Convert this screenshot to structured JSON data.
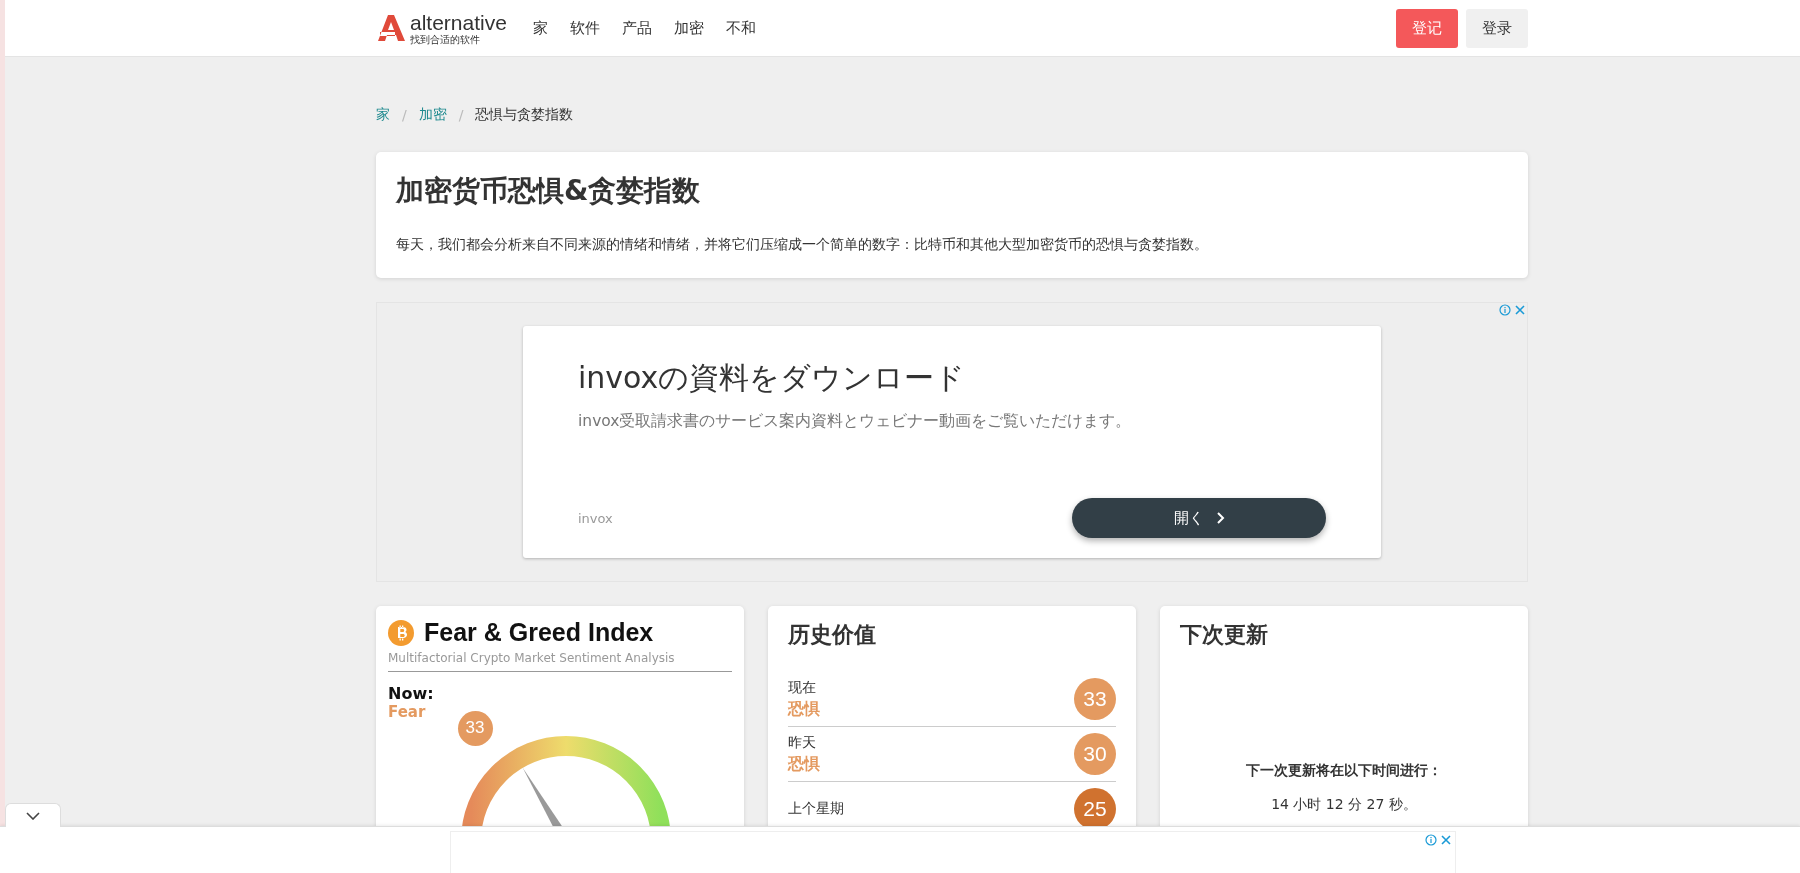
{
  "header": {
    "logo": {
      "name": "alternative",
      "tagline": "找到合适的软件"
    },
    "nav": [
      {
        "label": "家"
      },
      {
        "label": "软件"
      },
      {
        "label": "产品"
      },
      {
        "label": "加密"
      },
      {
        "label": "不和"
      }
    ],
    "buttons": [
      {
        "label": "登记",
        "kind": "primary"
      },
      {
        "label": "登录",
        "kind": "secondary"
      }
    ]
  },
  "breadcrumb_separator": "/",
  "breadcrumb": [
    {
      "label": "家",
      "link": true
    },
    {
      "label": "加密",
      "link": true
    },
    {
      "label": "恐惧与贪婪指数",
      "link": false
    }
  ],
  "intro": {
    "title": "加密货币恐惧&贪婪指数",
    "text": "每天，我们都会分析来自不同来源的情绪和情绪，并将它们压缩成一个简单的数字：比特币和其他大型加密货币的恐惧与贪婪指数。"
  },
  "ad": {
    "headline": "invoxの資料をダウンロード",
    "description": "invox受取請求書のサービス案内資料とウェビナー動画をご覧いただけます。",
    "advertiser": "invox",
    "button": "開く"
  },
  "index_card": {
    "title": "Fear & Greed Index",
    "subtitle": "Multifactorial Crypto Market Sentiment Analysis",
    "now_label": "Now:",
    "now_status": "Fear",
    "value": "33",
    "gauge": {
      "level": 0.33
    }
  },
  "history": {
    "title": "历史价值",
    "rows": [
      {
        "label": "现在",
        "status": "恐惧",
        "value": "33",
        "color": "#e49a60"
      },
      {
        "label": "昨天",
        "status": "恐惧",
        "value": "30",
        "color": "#e49a60"
      },
      {
        "label": "上个星期",
        "value": "25",
        "color": "#d0722f"
      }
    ]
  },
  "next_update": {
    "title": "下次更新",
    "label": "下一次更新将在以下时间进行：",
    "countdown": "14 小时 12 分 27 秒。"
  }
}
